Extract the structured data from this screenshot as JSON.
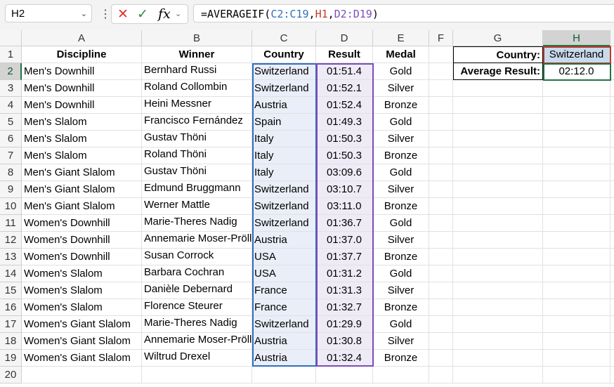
{
  "name_box": "H2",
  "formula": {
    "prefix": "=AVERAGEIF(",
    "arg1": "C2:C19",
    "sep1": ",",
    "arg2": "H1",
    "sep2": ",",
    "arg3": "D2:D19",
    "suffix": ")"
  },
  "columns": [
    "A",
    "B",
    "C",
    "D",
    "E",
    "F",
    "G",
    "H"
  ],
  "headers": [
    "Discipline",
    "Winner",
    "Country",
    "Result",
    "Medal"
  ],
  "rows": [
    [
      "Men's Downhill",
      "Bernhard Russi",
      "Switzerland",
      "01:51.4",
      "Gold"
    ],
    [
      "Men's Downhill",
      "Roland Collombin",
      "Switzerland",
      "01:52.1",
      "Silver"
    ],
    [
      "Men's Downhill",
      "Heini Messner",
      "Austria",
      "01:52.4",
      "Bronze"
    ],
    [
      "Men's Slalom",
      "Francisco Fernández",
      "Spain",
      "01:49.3",
      "Gold"
    ],
    [
      "Men's Slalom",
      "Gustav Thöni",
      "Italy",
      "01:50.3",
      "Silver"
    ],
    [
      "Men's Slalom",
      "Roland Thöni",
      "Italy",
      "01:50.3",
      "Bronze"
    ],
    [
      "Men's Giant Slalom",
      "Gustav Thöni",
      "Italy",
      "03:09.6",
      "Gold"
    ],
    [
      "Men's Giant Slalom",
      "Edmund Bruggmann",
      "Switzerland",
      "03:10.7",
      "Silver"
    ],
    [
      "Men's Giant Slalom",
      "Werner Mattle",
      "Switzerland",
      "03:11.0",
      "Bronze"
    ],
    [
      "Women's Downhill",
      "Marie-Theres Nadig",
      "Switzerland",
      "01:36.7",
      "Gold"
    ],
    [
      "Women's Downhill",
      "Annemarie Moser-Pröll",
      "Austria",
      "01:37.0",
      "Silver"
    ],
    [
      "Women's Downhill",
      "Susan Corrock",
      "USA",
      "01:37.7",
      "Bronze"
    ],
    [
      "Women's Slalom",
      "Barbara Cochran",
      "USA",
      "01:31.2",
      "Gold"
    ],
    [
      "Women's Slalom",
      "Danièle Debernard",
      "France",
      "01:31.3",
      "Silver"
    ],
    [
      "Women's Slalom",
      "Florence Steurer",
      "France",
      "01:32.7",
      "Bronze"
    ],
    [
      "Women's Giant Slalom",
      "Marie-Theres Nadig",
      "Switzerland",
      "01:29.9",
      "Gold"
    ],
    [
      "Women's Giant Slalom",
      "Annemarie Moser-Pröll",
      "Austria",
      "01:30.8",
      "Silver"
    ],
    [
      "Women's Giant Slalom",
      "Wiltrud Drexel",
      "Austria",
      "01:32.4",
      "Bronze"
    ]
  ],
  "lookup": {
    "country_label": "Country:",
    "country_value": "Switzerland",
    "avg_label": "Average Result:",
    "avg_value": "02:12.0"
  },
  "colors": {
    "c_ref": "#2f6fc1",
    "h_ref": "#c0392b",
    "d_ref": "#7c4dbb",
    "active": "#217346"
  }
}
